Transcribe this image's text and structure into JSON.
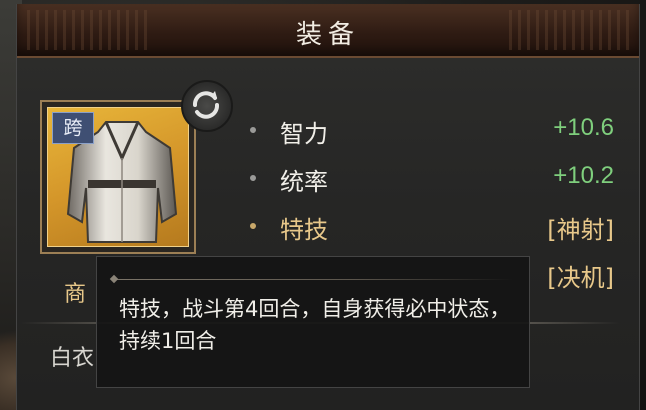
{
  "title": "装备",
  "item": {
    "tag": "跨",
    "icon": "robe-icon"
  },
  "swap_icon": "swap-icon",
  "stats": [
    {
      "name": "智力",
      "value": "+10.6"
    },
    {
      "name": "统率",
      "value": "+10.2"
    }
  ],
  "skill": {
    "name": "特技",
    "value": "[神射]",
    "value2": "[决机]"
  },
  "owner": "商",
  "item_name_partial": "白衣",
  "tooltip": {
    "text": "特技，战斗第4回合，自身获得必中状态，持续1回合"
  },
  "colors": {
    "stat_value": "#7fcf7d",
    "skill_gold": "#e8c88a",
    "item_bg": "#d4962a"
  }
}
